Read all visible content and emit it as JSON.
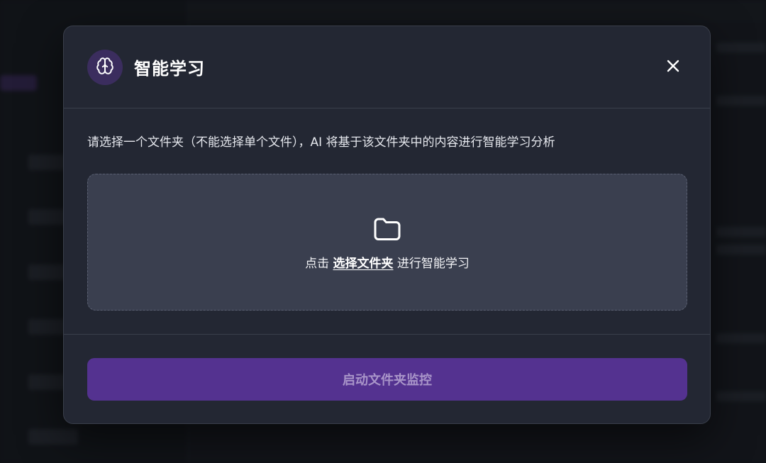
{
  "modal": {
    "title": "智能学习",
    "instruction": "请选择一个文件夹（不能选择单个文件），AI 将基于该文件夹中的内容进行智能学习分析",
    "dropzone": {
      "prefix": "点击 ",
      "link": "选择文件夹",
      "suffix": " 进行智能学习"
    },
    "start_button": "启动文件夹监控"
  },
  "icons": {
    "header": "brain-icon",
    "close": "close-icon",
    "dropzone": "folder-icon"
  },
  "colors": {
    "modal_bg": "#232733",
    "dropzone_bg": "#3a3f4f",
    "accent": "#543290",
    "button_text": "#a995c9",
    "badge_bg": "#3b2d5e"
  }
}
